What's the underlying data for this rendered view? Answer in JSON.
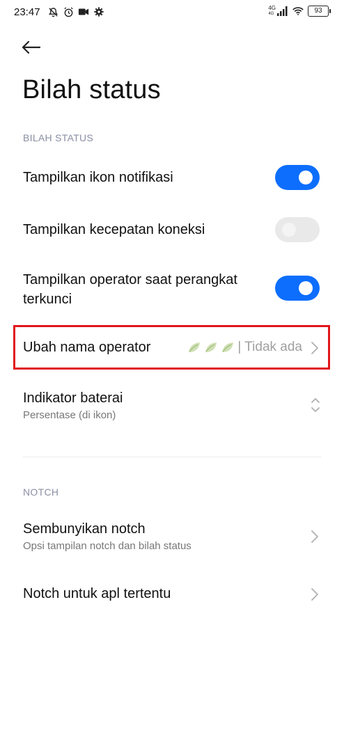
{
  "status_bar": {
    "time": "23:47",
    "network_label_top": "4G",
    "network_label_bottom": "4G",
    "battery": "93",
    "icons_left": [
      "notifications-off-icon",
      "alarm-icon",
      "video-camera-icon",
      "gear-icon"
    ],
    "icons_right": [
      "signal-icon",
      "wifi-icon",
      "battery-icon"
    ]
  },
  "header": {
    "back_icon": "arrow-left-icon",
    "title": "Bilah status"
  },
  "sections": {
    "status_bar_header": "BILAH STATUS",
    "notch_header": "NOTCH"
  },
  "settings": {
    "show_notification_icons": {
      "label": "Tampilkan ikon notifikasi",
      "enabled": true
    },
    "show_connection_speed": {
      "label": "Tampilkan kecepatan koneksi",
      "enabled": false
    },
    "show_operator_locked": {
      "label_line1": "Tampilkan operator saat perangkat",
      "label_line2": "terkunci",
      "enabled": true
    },
    "change_operator_name": {
      "label": "Ubah nama operator",
      "value": "| Tidak ada"
    },
    "battery_indicator": {
      "label": "Indikator baterai",
      "sub": "Persentase (di ikon)"
    },
    "hide_notch": {
      "label": "Sembunyikan notch",
      "sub": "Opsi tampilan notch dan bilah status"
    },
    "notch_for_apps": {
      "label": "Notch untuk apl tertentu"
    }
  },
  "colors": {
    "accent": "#0d6efd",
    "highlight": "#e0161c",
    "section_header": "#8a8fa3"
  }
}
